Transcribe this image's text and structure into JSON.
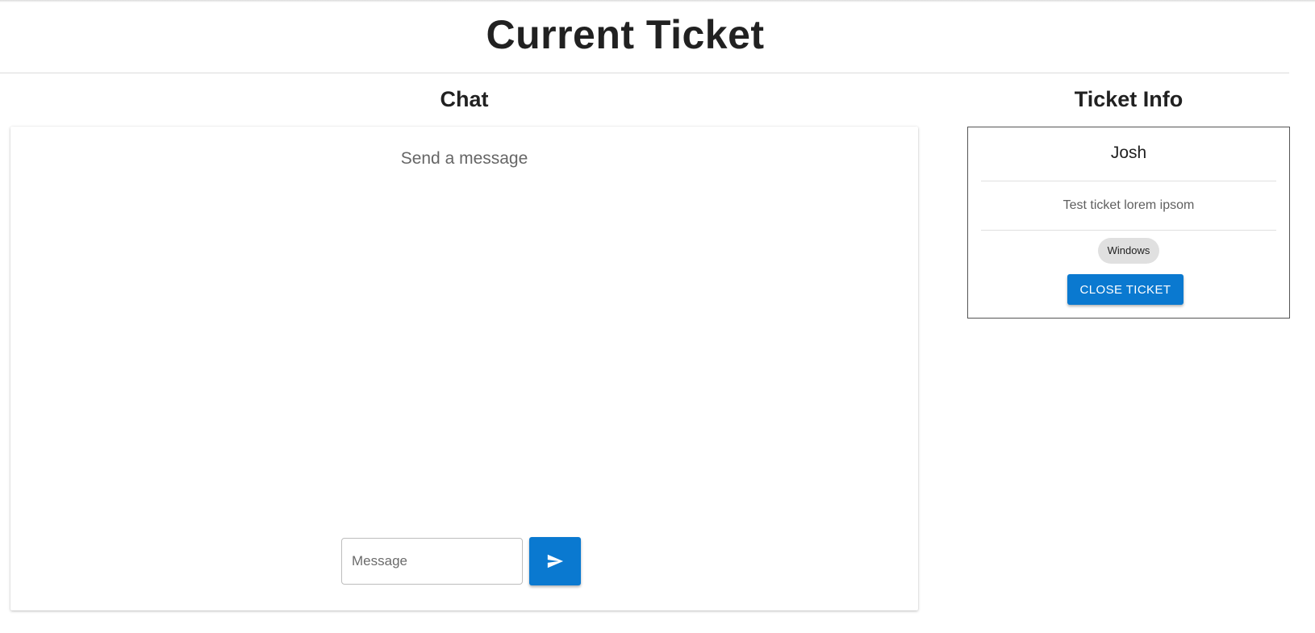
{
  "page": {
    "title": "Current Ticket"
  },
  "chat": {
    "heading": "Chat",
    "empty_text": "Send a message",
    "input_placeholder": "Message",
    "input_value": "",
    "send_icon": "send-icon"
  },
  "ticket_info": {
    "heading": "Ticket Info",
    "name": "Josh",
    "description": "Test ticket lorem ipsom",
    "tag": "Windows",
    "close_label": "CLOSE TICKET"
  },
  "colors": {
    "accent": "#0a79d0",
    "chip_bg": "#e0e0e0",
    "text": "#212121"
  }
}
